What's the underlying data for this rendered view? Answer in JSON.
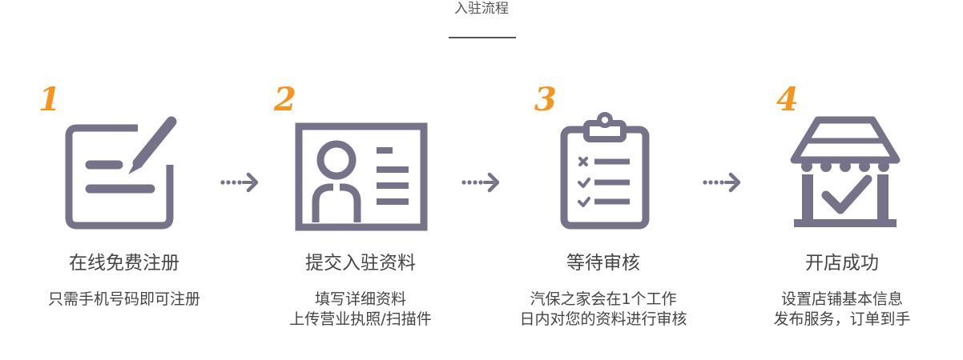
{
  "header": {
    "title": "入驻流程"
  },
  "steps": [
    {
      "number": "1",
      "title": "在线免费注册",
      "desc_lines": [
        "只需手机号码即可注册"
      ],
      "icon": "registration-form-icon"
    },
    {
      "number": "2",
      "title": "提交入驻资料",
      "desc_lines": [
        "填写详细资料",
        "上传营业执照/扫描件"
      ],
      "icon": "id-card-icon"
    },
    {
      "number": "3",
      "title": "等待审核",
      "desc_lines": [
        "汽保之家会在1个工作",
        "日内对您的资料进行审核"
      ],
      "icon": "clipboard-checklist-icon"
    },
    {
      "number": "4",
      "title": "开店成功",
      "desc_lines": [
        "设置店铺基本信息",
        "发布服务，订单到手"
      ],
      "icon": "storefront-check-icon"
    }
  ],
  "colors": {
    "icon": "#75728a",
    "accent": "#f7941d",
    "text": "#444444"
  }
}
